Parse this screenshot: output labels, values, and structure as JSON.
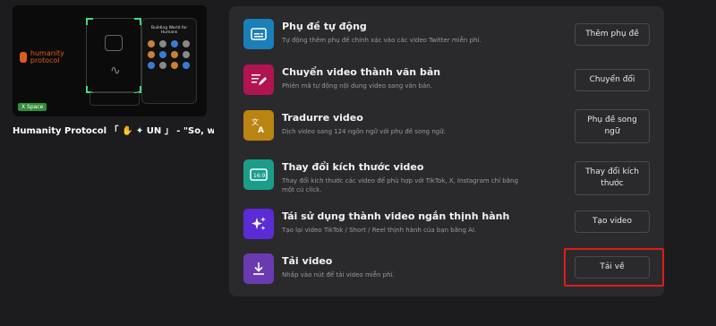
{
  "video": {
    "title": "Humanity Protocol 「 ✋ ✦ UN 」 - \"So, when w...",
    "logo_text": "humanity protocol",
    "panel_title": "Building World for Humans",
    "badge": "X Space"
  },
  "tools": [
    {
      "title": "Phụ đề tự động",
      "desc": "Tự động thêm phụ đề chính xác vào các video Twitter miễn phí.",
      "button": "Thêm phụ đề",
      "icon": "subtitles-icon",
      "color": "#1b7fb8"
    },
    {
      "title": "Chuyển video thành văn bản",
      "desc": "Phiên mã tự động nội dung video sang văn bản.",
      "button": "Chuyển đổi",
      "icon": "document-edit-icon",
      "color": "#b0154f"
    },
    {
      "title": "Tradurre video",
      "desc": "Dịch video sang 124 ngôn ngữ với phụ đề song ngữ.",
      "button": "Phụ đề song ngữ",
      "icon": "translate-icon",
      "color": "#b98412"
    },
    {
      "title": "Thay đổi kích thước video",
      "desc": "Thay đổi kích thước các video để phù hợp với TikTok, X, Instagram chỉ bằng một cú click.",
      "button": "Thay đổi kích thước",
      "icon": "aspect-ratio-icon",
      "color": "#1a9e8a"
    },
    {
      "title": "Tái sử dụng thành video ngắn thịnh hành",
      "desc": "Tạo lại video TikTok / Short / Reel thịnh hành của bạn bằng AI.",
      "button": "Tạo video",
      "icon": "sparkles-icon",
      "color": "#5b2bd6"
    },
    {
      "title": "Tải video",
      "desc": "Nhấp vào nút để tải video miễn phí.",
      "button": "Tải về",
      "icon": "download-icon",
      "color": "#6a3bb0"
    }
  ]
}
